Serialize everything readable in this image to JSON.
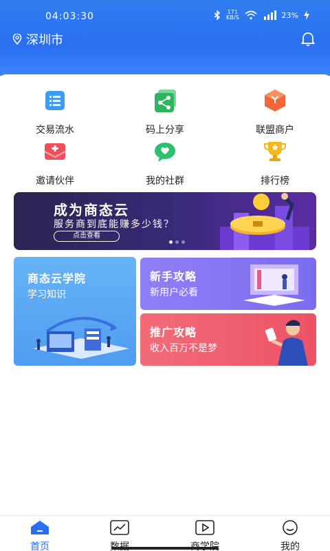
{
  "status": {
    "time": "04:03:30",
    "net_speed_value": "171",
    "net_speed_unit": "KB/S",
    "battery": "23%"
  },
  "header": {
    "city": "深圳市"
  },
  "grid": [
    {
      "label": "交易流水",
      "icon": "list-icon",
      "color": "#3d9cf3"
    },
    {
      "label": "码上分享",
      "icon": "share-icon",
      "color": "#2db55d"
    },
    {
      "label": "联盟商户",
      "icon": "cube-icon",
      "color": "#f2673a"
    },
    {
      "label": "邀请伙伴",
      "icon": "envelope-icon",
      "color": "#ee4f5c"
    },
    {
      "label": "我的社群",
      "icon": "chat-icon",
      "color": "#2fbf71"
    },
    {
      "label": "排行榜",
      "icon": "trophy-icon",
      "color": "#f5b818"
    }
  ],
  "banner": {
    "title": "成为商态云",
    "subtitle": "服务商到底能赚多少钱？",
    "button": "点击查看"
  },
  "cards": {
    "academy": {
      "title": "商态云学院",
      "subtitle": "学习知识",
      "color": "#5aa8f5"
    },
    "newbie": {
      "title": "新手攻略",
      "subtitle": "新用户必看",
      "color": "#8a7cf3"
    },
    "promo": {
      "title": "推广攻略",
      "subtitle": "收入百万不是梦",
      "color": "#ef5c6b"
    }
  },
  "bottom_nav": [
    {
      "label": "首页",
      "icon": "home-icon",
      "active": true
    },
    {
      "label": "数据",
      "icon": "chart-icon",
      "active": false
    },
    {
      "label": "商学院",
      "icon": "play-icon",
      "active": false
    },
    {
      "label": "我的",
      "icon": "profile-icon",
      "active": false
    }
  ],
  "colors": {
    "primary": "#2a6ff0"
  }
}
